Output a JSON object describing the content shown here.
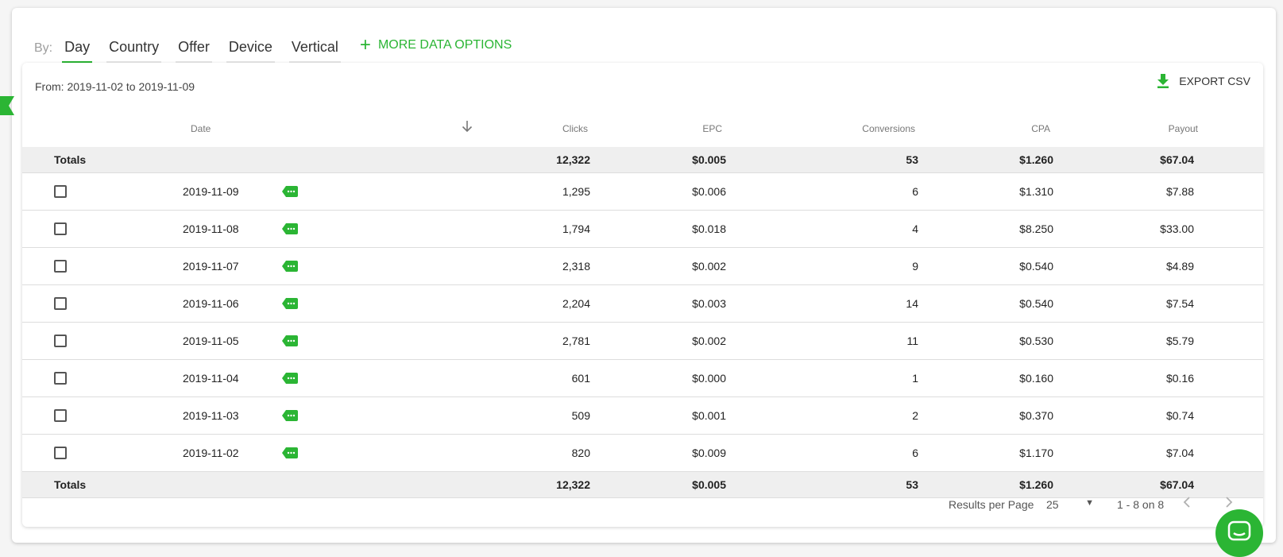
{
  "tabs": {
    "by_label": "By:",
    "items": [
      "Day",
      "Country",
      "Offer",
      "Device",
      "Vertical"
    ],
    "active": 0,
    "more_label": "MORE DATA OPTIONS"
  },
  "report": {
    "range_label": "From: 2019-11-02 to 2019-11-09",
    "export_label": "EXPORT CSV"
  },
  "columns": {
    "date": "Date",
    "clicks": "Clicks",
    "epc": "EPC",
    "conversions": "Conversions",
    "cpa": "CPA",
    "payout": "Payout"
  },
  "totals": {
    "label": "Totals",
    "clicks": "12,322",
    "epc": "$0.005",
    "conversions": "53",
    "cpa": "$1.260",
    "payout": "$67.04"
  },
  "rows": [
    {
      "date": "2019-11-09",
      "clicks": "1,295",
      "epc": "$0.006",
      "conversions": "6",
      "cpa": "$1.310",
      "payout": "$7.88"
    },
    {
      "date": "2019-11-08",
      "clicks": "1,794",
      "epc": "$0.018",
      "conversions": "4",
      "cpa": "$8.250",
      "payout": "$33.00"
    },
    {
      "date": "2019-11-07",
      "clicks": "2,318",
      "epc": "$0.002",
      "conversions": "9",
      "cpa": "$0.540",
      "payout": "$4.89"
    },
    {
      "date": "2019-11-06",
      "clicks": "2,204",
      "epc": "$0.003",
      "conversions": "14",
      "cpa": "$0.540",
      "payout": "$7.54"
    },
    {
      "date": "2019-11-05",
      "clicks": "2,781",
      "epc": "$0.002",
      "conversions": "11",
      "cpa": "$0.530",
      "payout": "$5.79"
    },
    {
      "date": "2019-11-04",
      "clicks": "601",
      "epc": "$0.000",
      "conversions": "1",
      "cpa": "$0.160",
      "payout": "$0.16"
    },
    {
      "date": "2019-11-03",
      "clicks": "509",
      "epc": "$0.001",
      "conversions": "2",
      "cpa": "$0.370",
      "payout": "$0.74"
    },
    {
      "date": "2019-11-02",
      "clicks": "820",
      "epc": "$0.009",
      "conversions": "6",
      "cpa": "$1.170",
      "payout": "$7.04"
    }
  ],
  "pagination": {
    "per_page_label": "Results per Page",
    "per_page_value": "25",
    "count_label": "1 - 8 on 8"
  },
  "colors": {
    "accent": "#2bb534",
    "totals_bg": "#efefef"
  },
  "icons": {
    "sort": "arrow-down-icon",
    "export": "download-icon",
    "row_tag": "tag-icon",
    "prev": "chevron-left-icon",
    "next": "chevron-right-icon",
    "dropdown": "caret-down-icon",
    "chat": "chat-icon"
  }
}
